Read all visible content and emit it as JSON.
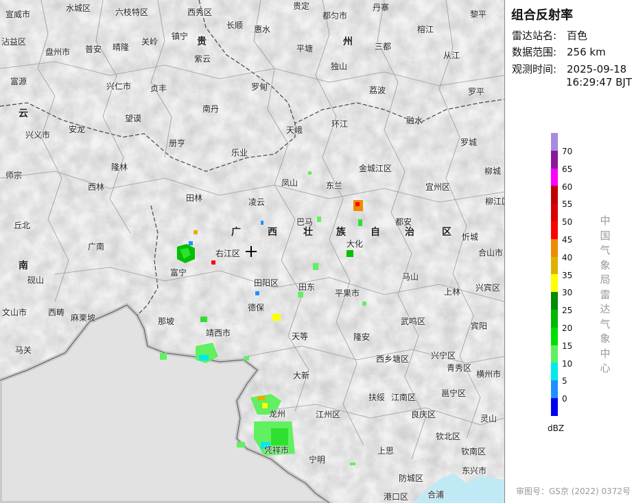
{
  "title": "组合反射率",
  "meta": [
    {
      "label": "雷达站名:",
      "value": "百色"
    },
    {
      "label": "数据范围:",
      "value": "256 km"
    },
    {
      "label": "观测时间:",
      "value": "2025-09-18"
    }
  ],
  "time_line2": "16:29:47 BJT",
  "legend": {
    "unit": "dBZ",
    "ticks": [
      "70",
      "65",
      "60",
      "55",
      "50",
      "45",
      "40",
      "35",
      "30",
      "25",
      "20",
      "15",
      "10",
      "5",
      "0"
    ],
    "colors": [
      "#a78bde",
      "#8a1a9a",
      "#ff00ff",
      "#c00000",
      "#d80000",
      "#ff0000",
      "#f08a00",
      "#e0b000",
      "#ffff00",
      "#008c00",
      "#00b800",
      "#00e000",
      "#60f060",
      "#00eaea",
      "#1e90ff",
      "#0000f0"
    ]
  },
  "agency": "中国气象局雷达气象中心",
  "review_no": "审图号：GS京 (2022) 0372号",
  "map": {
    "station_marker": "crosshair-icon",
    "provinces": [
      "贵",
      "州",
      "云",
      "南",
      "广",
      "西",
      "壮",
      "族",
      "自",
      "治",
      "区"
    ],
    "places": [
      "宣威市",
      "水城区",
      "六枝特区",
      "西秀区",
      "贵定",
      "都匀市",
      "丹寨",
      "黎平",
      "沾益区",
      "盘州市",
      "普安",
      "晴隆",
      "关岭",
      "镇宁",
      "长顺",
      "惠水",
      "三都",
      "榕江",
      "富源",
      "紫云",
      "平塘",
      "独山",
      "从江",
      "兴仁市",
      "贞丰",
      "罗甸",
      "荔波",
      "罗平",
      "兴义市",
      "安龙",
      "望谟",
      "南丹",
      "环江",
      "融水",
      "师宗",
      "册亨",
      "天峨",
      "罗城",
      "丘北",
      "隆林",
      "乐业",
      "金城江区",
      "柳城",
      "西林",
      "凤山",
      "东兰",
      "宜州区",
      "柳江区",
      "田林",
      "凌云",
      "巴马",
      "都安",
      "忻城",
      "广南",
      "右江区",
      "大化",
      "合山市",
      "富宁",
      "田阳区",
      "马山",
      "砚山",
      "田东",
      "平果市",
      "上林",
      "兴宾区",
      "文山市",
      "西畴",
      "麻栗坡",
      "那坡",
      "德保",
      "武鸣区",
      "宾阳",
      "靖西市",
      "天等",
      "隆安",
      "马关",
      "西乡塘区",
      "兴宁区",
      "青秀区",
      "横州市",
      "大新",
      "扶绥",
      "江南区",
      "邕宁区",
      "龙州",
      "江州区",
      "良庆区",
      "灵山",
      "凭祥市",
      "钦北区",
      "宁明",
      "上思",
      "钦南区",
      "防城区",
      "东兴市",
      "港口区",
      "合浦"
    ]
  }
}
